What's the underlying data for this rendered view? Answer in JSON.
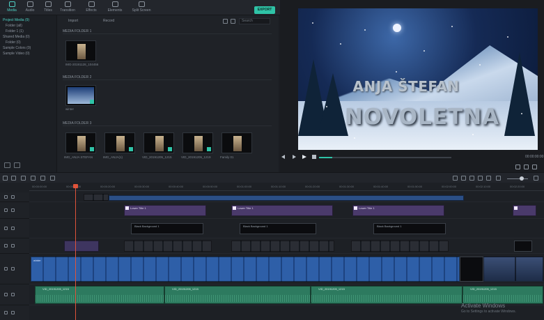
{
  "toolbar": {
    "tabs": [
      "Media",
      "Audio",
      "Titles",
      "Transition",
      "Effects",
      "Elements",
      "Split Screen"
    ],
    "export_label": "EXPORT"
  },
  "library": {
    "sidebar_items": [
      "Project Media (9)",
      "Folder (all)",
      "Folder 1 (1)",
      "Shared Media (0)",
      "Folder (0)",
      "Sample Colors (0)",
      "Sample Video (0)"
    ],
    "dropdown_import": "Import",
    "dropdown_record": "Record",
    "search_placeholder": "Search",
    "folders": [
      {
        "name": "MEDIA FOLDER 1",
        "items": [
          {
            "label": "IMG-20191128_104456"
          }
        ]
      },
      {
        "name": "MEDIA FOLDER 2",
        "items": [
          {
            "label": "winter"
          }
        ]
      },
      {
        "name": "MEDIA FOLDER 3",
        "items": [
          {
            "label": "IMG_ANJA STEFAN"
          },
          {
            "label": "IMG_ANJA(1)"
          },
          {
            "label": "VID_20191205_1215"
          },
          {
            "label": "VID_20191205_1219"
          },
          {
            "label": "Family 01"
          }
        ]
      }
    ]
  },
  "preview": {
    "title_line1": "ANJA ŠTEFAN",
    "title_line2": "NOVOLETNA",
    "playback_progress": 0.1,
    "timecode": "00:00:00:00"
  },
  "timeline": {
    "ruler_labels": [
      "00:00:00:00",
      "00:00:10:00",
      "00:00:20:00",
      "00:00:30:00",
      "00:00:40:00",
      "00:00:50:00",
      "00:01:00:00",
      "00:01:10:00",
      "00:01:20:00",
      "00:01:30:00",
      "00:01:40:00",
      "00:01:50:00",
      "00:02:00:00",
      "00:02:10:00",
      "00:02:20:00",
      "00:02:30:00"
    ],
    "title_clip_label": "Lower Title 1",
    "black_clip_label": "Black Background 1",
    "video_clip_label": "winter",
    "audio_clip_label": "VID_20191205_1215"
  },
  "watermark": {
    "line1": "Activate Windows",
    "line2": "Go to Settings to activate Windows."
  }
}
